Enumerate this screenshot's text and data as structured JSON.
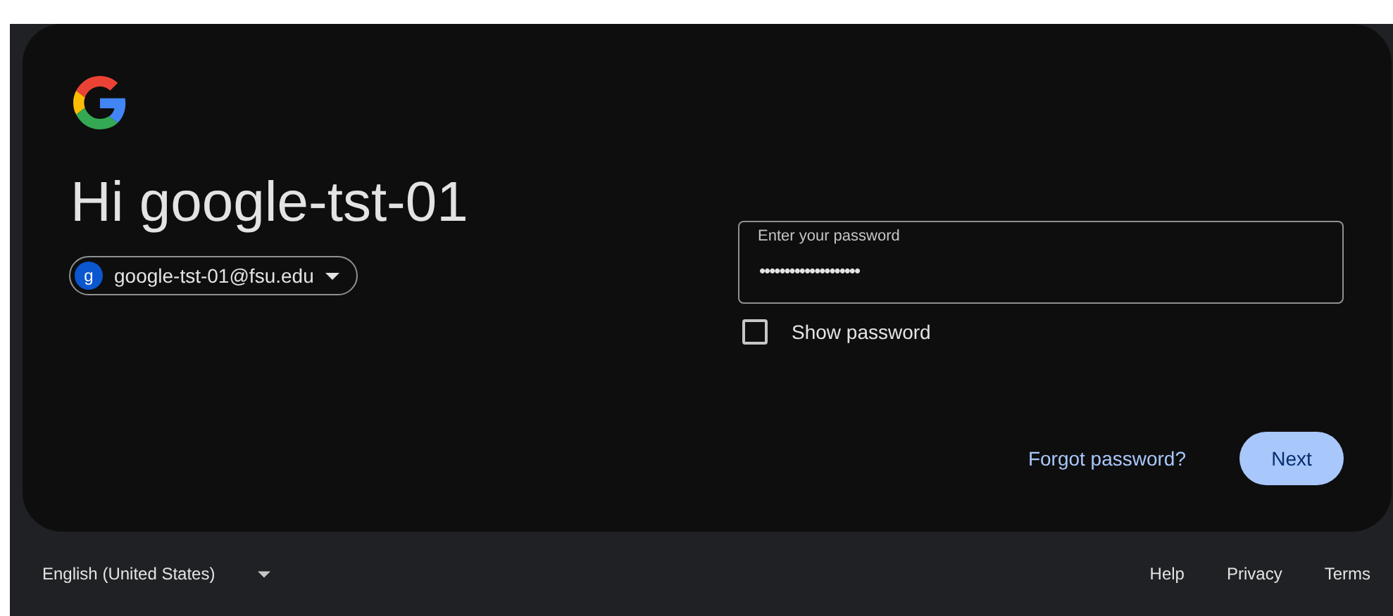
{
  "heading": "Hi google-tst-01",
  "account_chip": {
    "avatar_letter": "g",
    "email": "google-tst-01@fsu.edu"
  },
  "password_field": {
    "label": "Enter your password",
    "value": "••••••••••••••••••••"
  },
  "show_password": {
    "label": "Show password",
    "checked": false
  },
  "forgot_link": "Forgot password?",
  "next_button": "Next",
  "footer": {
    "language": "English (United States)",
    "links": [
      "Help",
      "Privacy",
      "Terms"
    ]
  }
}
